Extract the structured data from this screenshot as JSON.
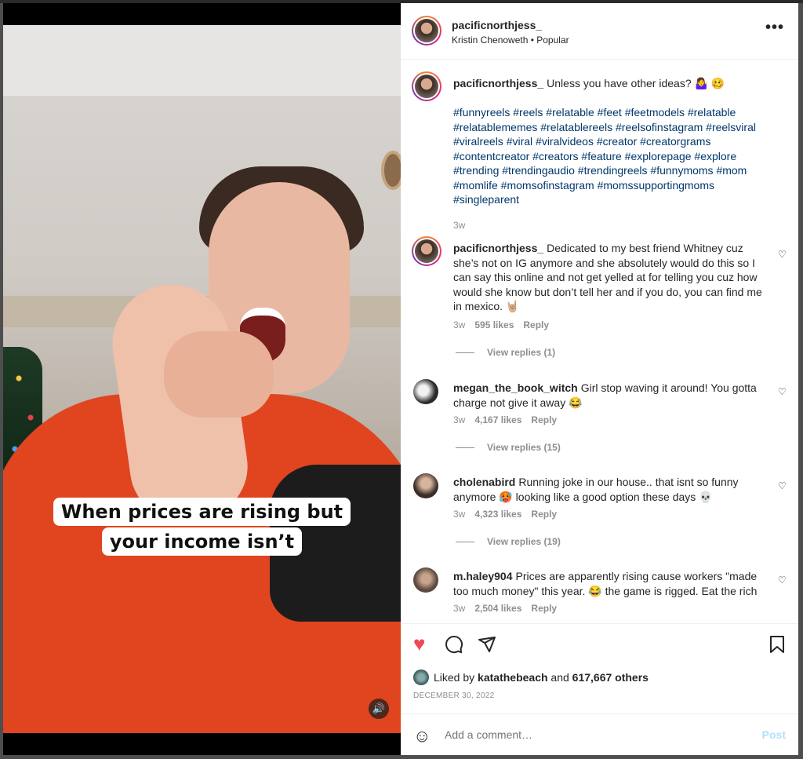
{
  "video": {
    "caption_line1": "When prices are rising but",
    "caption_line2": "your income isn’t",
    "mute_icon": "🔊"
  },
  "header": {
    "username": "pacificnorthjess_",
    "subline": "Kristin Chenoweth • Popular",
    "more_icon": "•••"
  },
  "post": {
    "author": "pacificnorthjess_",
    "text": "Unless you have other ideas? 🤷‍♀️ 🥴",
    "hashtags": "#funnyreels #reels #relatable #feet #feetmodels #relatable #relatablememes #relatablereels #reelsofinstagram #reelsviral #viralreels #viral #viralvideos #creator #creatorgrams #contentcreator #creators #feature #explorepage #explore #trending #trendingaudio #trendingreels #funnymoms #mom #momlife #momsofinstagram #momssupportingmoms #singleparent",
    "age": "3w"
  },
  "comments": [
    {
      "username": "pacificnorthjess_",
      "text": "Dedicated to my best friend Whitney cuz she’s not on IG anymore and she absolutely would do this so I can say this online and not get yelled at for telling you cuz how would she know but don’t tell her and if you do, you can find me in mexico. 🤘🏼",
      "age": "3w",
      "likes": "595 likes",
      "reply": "Reply",
      "view_replies": "View replies (1)"
    },
    {
      "username": "megan_the_book_witch",
      "text": "Girl stop waving it around! You gotta charge not give it away 😂",
      "age": "3w",
      "likes": "4,167 likes",
      "reply": "Reply",
      "view_replies": "View replies (15)"
    },
    {
      "username": "cholenabird",
      "text": "Running joke in our house.. that isnt so funny anymore 🥵 looking like a good option these days 💀",
      "age": "3w",
      "likes": "4,323 likes",
      "reply": "Reply",
      "view_replies": "View replies (19)"
    },
    {
      "username": "m.haley904",
      "text": "Prices are apparently rising cause workers \"made too much money\" this year. 😂 the game is rigged. Eat the rich",
      "age": "3w",
      "likes": "2,504 likes",
      "reply": "Reply"
    }
  ],
  "actions": {
    "like_icon": "♥",
    "comment_icon": "○",
    "share_icon": "➢",
    "save_icon": "🔖",
    "liked_by_prefix": "Liked by",
    "liked_by_user": "katathebeach",
    "liked_by_and": "and",
    "liked_by_others": "617,667 others",
    "date": "DECEMBER 30, 2022"
  },
  "add_comment": {
    "placeholder": "Add a comment…",
    "post_label": "Post",
    "smile_icon": "☺"
  },
  "colors": {
    "accent_heart": "#ed4956",
    "hashtag": "#00376b",
    "post_button": "#b2dffc"
  }
}
